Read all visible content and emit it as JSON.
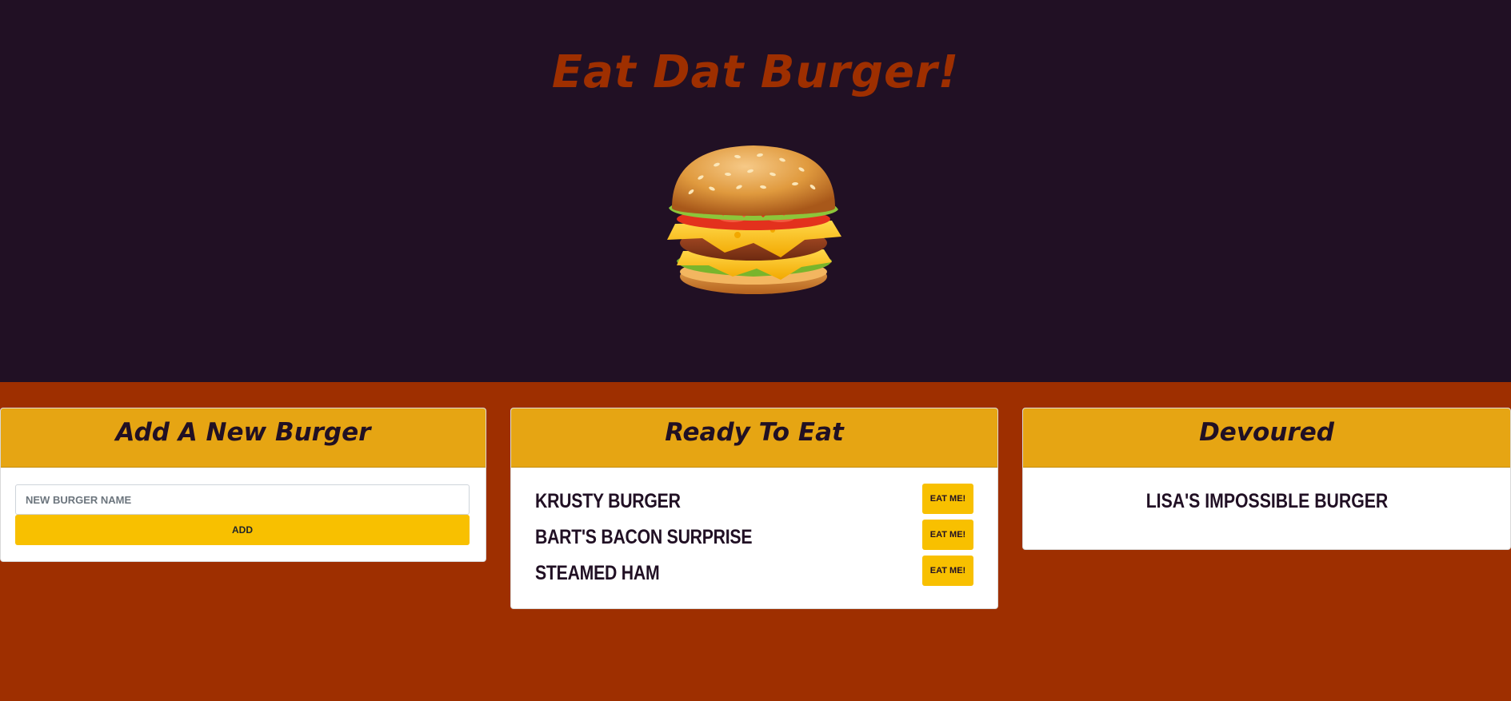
{
  "header": {
    "title": "Eat Dat Burger!"
  },
  "hero_image": {
    "icon": "burger-icon"
  },
  "add_card": {
    "title": "Add A New Burger",
    "input_placeholder": "NEW BURGER NAME",
    "input_value": "",
    "add_label": "ADD"
  },
  "ready_card": {
    "title": "Ready To Eat",
    "items": [
      {
        "name": "KRUSTY BURGER",
        "button_label": "EAT ME!"
      },
      {
        "name": "BART'S BACON SURPRISE",
        "button_label": "EAT ME!"
      },
      {
        "name": "STEAMED HAM",
        "button_label": "EAT ME!"
      }
    ]
  },
  "devoured_card": {
    "title": "Devoured",
    "items": [
      {
        "name": "LISA'S IMPOSSIBLE BURGER"
      }
    ]
  },
  "colors": {
    "hero_background": "#211024",
    "page_background": "#9e2f00",
    "card_header": "#e6a513",
    "button": "#f8c000",
    "title_text": "#9e2f00",
    "dark_text": "#211024"
  }
}
